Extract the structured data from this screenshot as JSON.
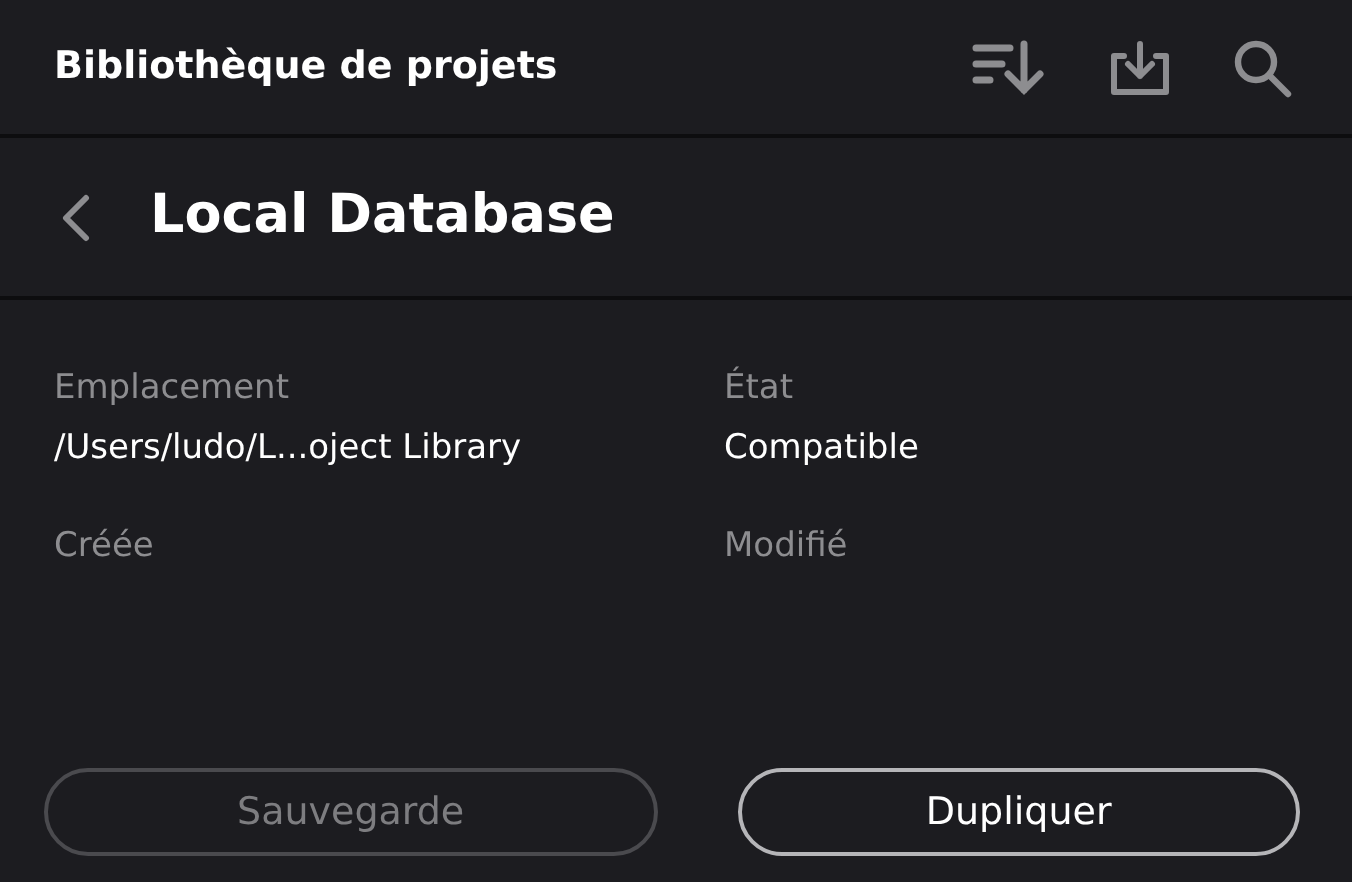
{
  "header": {
    "title": "Bibliothèque de projets"
  },
  "subheader": {
    "title": "Local Database"
  },
  "fields": [
    {
      "label": "Emplacement",
      "value": "/Users/ludo/L...oject Library"
    },
    {
      "label": "État",
      "value": "Compatible"
    },
    {
      "label": "Créée"
    },
    {
      "label": "Modifié"
    }
  ],
  "buttons": [
    {
      "label": "Sauvegarde",
      "disabled": true
    },
    {
      "label": "Dupliquer",
      "disabled": false
    }
  ]
}
